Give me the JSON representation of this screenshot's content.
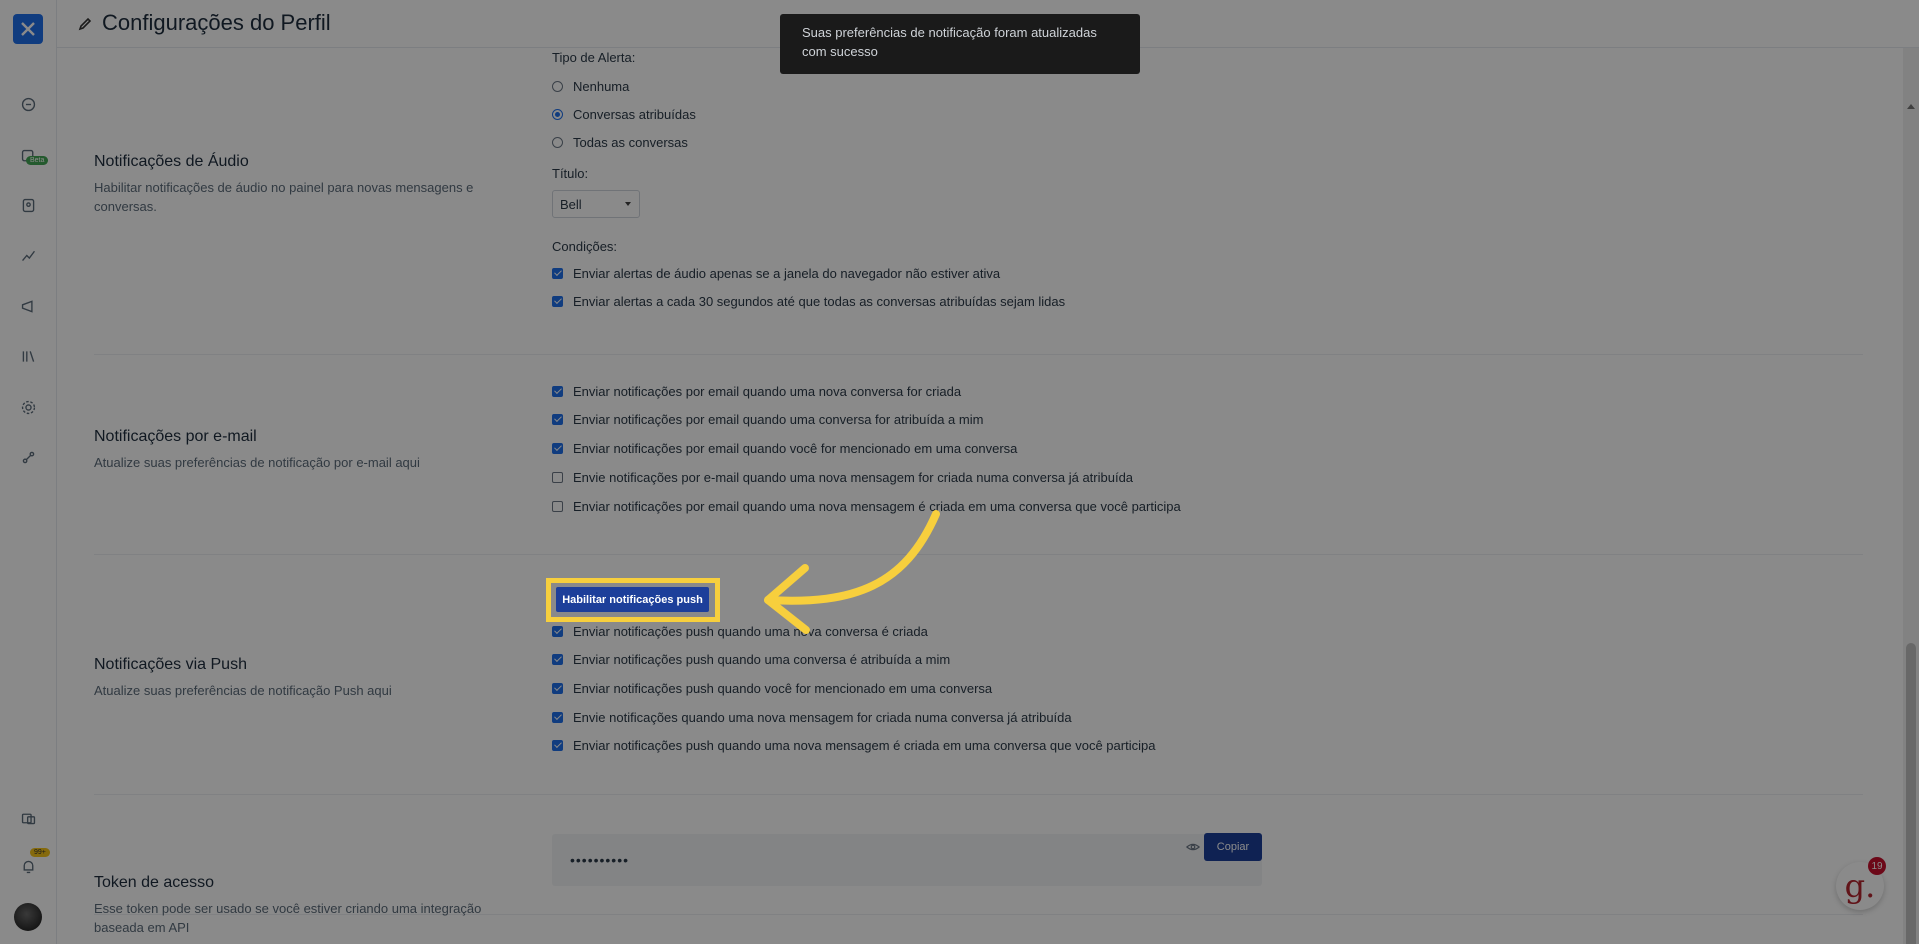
{
  "header": {
    "title": "Configurações do Perfil"
  },
  "sidebar": {
    "beta_badge": "Beta",
    "notification_badge": "99+"
  },
  "audio": {
    "title": "Notificações de Áudio",
    "description": "Habilitar notificações de áudio no painel para novas mensagens e conversas.",
    "alert_type_label": "Tipo de Alerta:",
    "alert_options": [
      {
        "label": "Nenhuma",
        "selected": false
      },
      {
        "label": "Conversas atribuídas",
        "selected": true
      },
      {
        "label": "Todas as conversas",
        "selected": false
      }
    ],
    "tone_label": "Título:",
    "tone_value": "Bell",
    "conditions_label": "Condições:",
    "conditions": [
      {
        "label": "Enviar alertas de áudio apenas se a janela do navegador não estiver ativa",
        "checked": true
      },
      {
        "label": "Enviar alertas a cada 30 segundos até que todas as conversas atribuídas sejam lidas",
        "checked": true
      }
    ]
  },
  "email": {
    "title": "Notificações por e-mail",
    "description": "Atualize suas preferências de notificação por e-mail aqui",
    "options": [
      {
        "label": "Enviar notificações por email quando uma nova conversa for criada",
        "checked": true
      },
      {
        "label": "Enviar notificações por email quando uma conversa for atribuída a mim",
        "checked": true
      },
      {
        "label": "Enviar notificações por email quando você for mencionado em uma conversa",
        "checked": true
      },
      {
        "label": "Envie notificações por e-mail quando uma nova mensagem for criada numa conversa já atribuída",
        "checked": false
      },
      {
        "label": "Enviar notificações por email quando uma nova mensagem é criada em uma conversa que você participa",
        "checked": false
      }
    ]
  },
  "push": {
    "title": "Notificações via Push",
    "description": "Atualize suas preferências de notificação Push aqui",
    "enable_button": "Habilitar notificações push",
    "options": [
      {
        "label": "Enviar notificações push quando uma nova conversa é criada",
        "checked": true
      },
      {
        "label": "Enviar notificações push quando uma conversa é atribuída a mim",
        "checked": true
      },
      {
        "label": "Enviar notificações push quando você for mencionado em uma conversa",
        "checked": true
      },
      {
        "label": "Envie notificações quando uma nova mensagem for criada numa conversa já atribuída",
        "checked": true
      },
      {
        "label": "Enviar notificações push quando uma nova mensagem é criada em uma conversa que você participa",
        "checked": true
      }
    ]
  },
  "token": {
    "title": "Token de acesso",
    "description": "Esse token pode ser usado se você estiver criando uma integração baseada em API",
    "value": "••••••••••",
    "copy_button": "Copiar"
  },
  "toast": {
    "message": "Suas preferências de notificação foram atualizadas com sucesso"
  },
  "chat_widget": {
    "badge": "19",
    "glyph": "g."
  },
  "colors": {
    "accent": "#1f6feb",
    "button": "#1d3f9a",
    "highlight": "#f7cf3d",
    "toast_bg": "#1a1a1a"
  }
}
